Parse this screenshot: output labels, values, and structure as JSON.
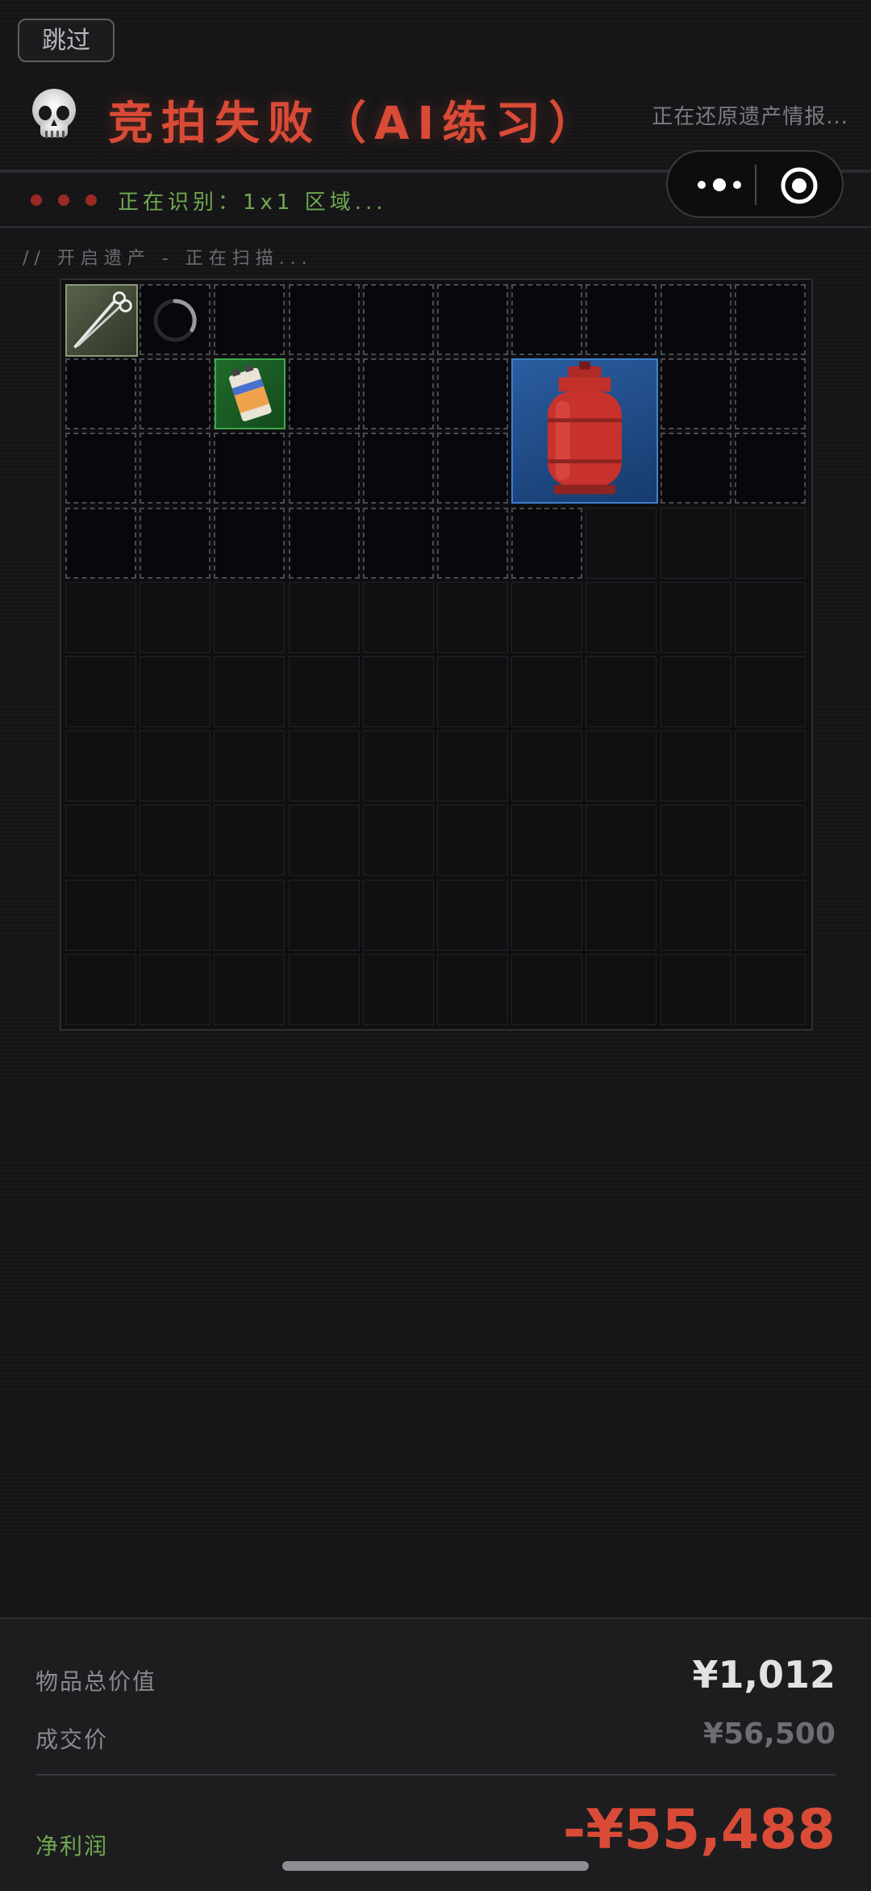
{
  "header": {
    "skip_label": "跳过",
    "title": "竞拍失败（AI练习）",
    "restoring_text": "正在还原遗产情报...",
    "identify_text": "正在识别：1x1 区域...",
    "scan_text": "// 开启遗产 - 正在扫描..."
  },
  "grid": {
    "columns": 10,
    "rows": 10,
    "items": [
      {
        "name": "scissors",
        "icon": "scissors-icon",
        "rarity_color": "#8c9a76"
      },
      {
        "name": "battery",
        "icon": "battery-icon",
        "rarity_color": "#3fa84a"
      },
      {
        "name": "gas-tank",
        "icon": "gas-tank-icon",
        "rarity_color": "#3f7fd0"
      }
    ]
  },
  "summary": {
    "total_label": "物品总价值",
    "total_value": "¥1,012",
    "deal_label": "成交价",
    "deal_value": "¥56,500",
    "profit_label": "净利润",
    "profit_value": "-¥55,488"
  },
  "colors": {
    "accent_red": "#d94b36",
    "accent_green": "#6fa84f",
    "background": "#151517"
  }
}
